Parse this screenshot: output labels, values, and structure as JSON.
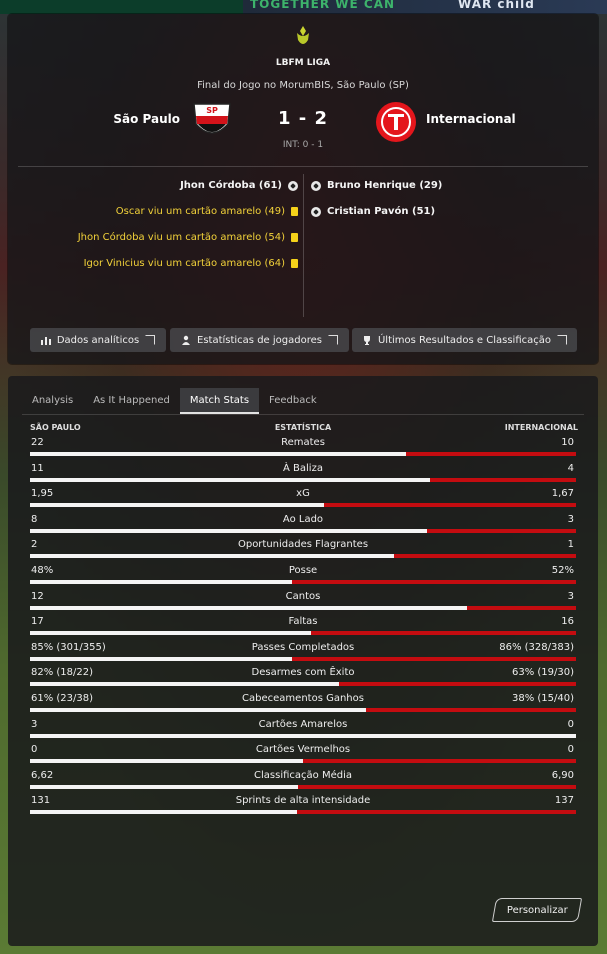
{
  "banner": {
    "left": "TOGETHER WE CAN",
    "right": "WAR child"
  },
  "header": {
    "league": "LBFM LIGA",
    "venue": "Final do Jogo no MorumBIS, São Paulo (SP)",
    "home_team": "São Paulo",
    "away_team": "Internacional",
    "score": "1 - 2",
    "halftime": "INT: 0 - 1",
    "home_events": [
      {
        "type": "goal",
        "text": "Jhon Córdoba (61)"
      },
      {
        "type": "card",
        "text": "Oscar viu um cartão amarelo (49)"
      },
      {
        "type": "card",
        "text": "Jhon Córdoba viu um cartão amarelo (54)"
      },
      {
        "type": "card",
        "text": "Igor Vinicius viu um cartão amarelo (64)"
      }
    ],
    "away_events": [
      {
        "type": "goal",
        "text": "Bruno Henrique (29)"
      },
      {
        "type": "goal",
        "text": "Cristian Pavón (51)"
      }
    ],
    "buttons": {
      "analytics": "Dados analíticos",
      "player_stats": "Estatísticas de jogadores",
      "results": "Últimos Resultados e Classificação"
    },
    "colors": {
      "card": "#f5d21a",
      "home_red": "#d2131a",
      "away_red": "#e4161c"
    }
  },
  "tabs": [
    "Analysis",
    "As It Happened",
    "Match Stats",
    "Feedback"
  ],
  "active_tab": "Match Stats",
  "columns": {
    "home": "SÃO PAULO",
    "stat": "ESTATÍSTICA",
    "away": "INTERNACIONAL"
  },
  "stats": [
    {
      "name": "Remates",
      "home": "22",
      "away": "10",
      "home_share": 0.688
    },
    {
      "name": "À Baliza",
      "home": "11",
      "away": "4",
      "home_share": 0.733
    },
    {
      "name": "xG",
      "home": "1,95",
      "away": "1,67",
      "home_share": 0.539
    },
    {
      "name": "Ao Lado",
      "home": "8",
      "away": "3",
      "home_share": 0.727
    },
    {
      "name": "Oportunidades Flagrantes",
      "home": "2",
      "away": "1",
      "home_share": 0.667
    },
    {
      "name": "Posse",
      "home": "48%",
      "away": "52%",
      "home_share": 0.48
    },
    {
      "name": "Cantos",
      "home": "12",
      "away": "3",
      "home_share": 0.8
    },
    {
      "name": "Faltas",
      "home": "17",
      "away": "16",
      "home_share": 0.515
    },
    {
      "name": "Passes Completados",
      "home": "85% (301/355)",
      "away": "86% (328/383)",
      "home_share": 0.479
    },
    {
      "name": "Desarmes com Êxito",
      "home": "82% (18/22)",
      "away": "63% (19/30)",
      "home_share": 0.566
    },
    {
      "name": "Cabeceamentos Ganhos",
      "home": "61% (23/38)",
      "away": "38% (15/40)",
      "home_share": 0.616
    },
    {
      "name": "Cartões Amarelos",
      "home": "3",
      "away": "0",
      "home_share": 1.0
    },
    {
      "name": "Cartões Vermelhos",
      "home": "0",
      "away": "0",
      "home_share": 0.5
    },
    {
      "name": "Classificação Média",
      "home": "6,62",
      "away": "6,90",
      "home_share": 0.49
    },
    {
      "name": "Sprints de alta intensidade",
      "home": "131",
      "away": "137",
      "home_share": 0.489
    }
  ],
  "customize_button": "Personalizar"
}
